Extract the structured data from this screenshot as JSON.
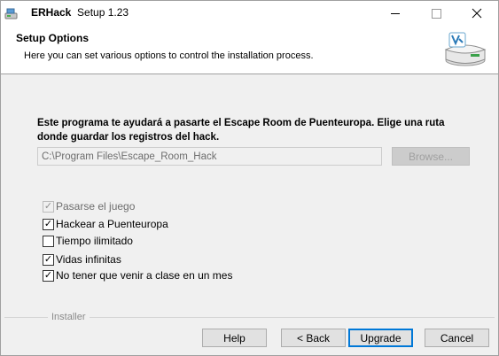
{
  "window": {
    "app_name": "ERHack",
    "title_rest": "Setup 1.23"
  },
  "header": {
    "title": "Setup Options",
    "subtitle": "Here you can set various options to control the installation process."
  },
  "body": {
    "description": "Este programa te ayudará a pasarte el Escape Room de Puenteuropa. Elige una ruta donde guardar los registros del hack.",
    "path_value": "C:\\Program Files\\Escape_Room_Hack",
    "browse_label": "Browse..."
  },
  "options": [
    {
      "label": "Pasarse el juego",
      "checked": true,
      "disabled": true
    },
    {
      "label": "Hackear a Puenteuropa",
      "checked": true,
      "disabled": false
    },
    {
      "label": "Tiempo ilimitado",
      "checked": false,
      "disabled": false
    },
    {
      "label": "Vidas infinitas",
      "checked": true,
      "disabled": false
    },
    {
      "label": "No tener que venir a clase en un mes",
      "checked": true,
      "disabled": false
    }
  ],
  "footer": {
    "group_label": "Installer",
    "help_label": "Help",
    "back_label": "< Back",
    "upgrade_label": "Upgrade",
    "cancel_label": "Cancel"
  },
  "colors": {
    "accent": "#0078d7",
    "dialog_bg": "#f0f0f0"
  }
}
